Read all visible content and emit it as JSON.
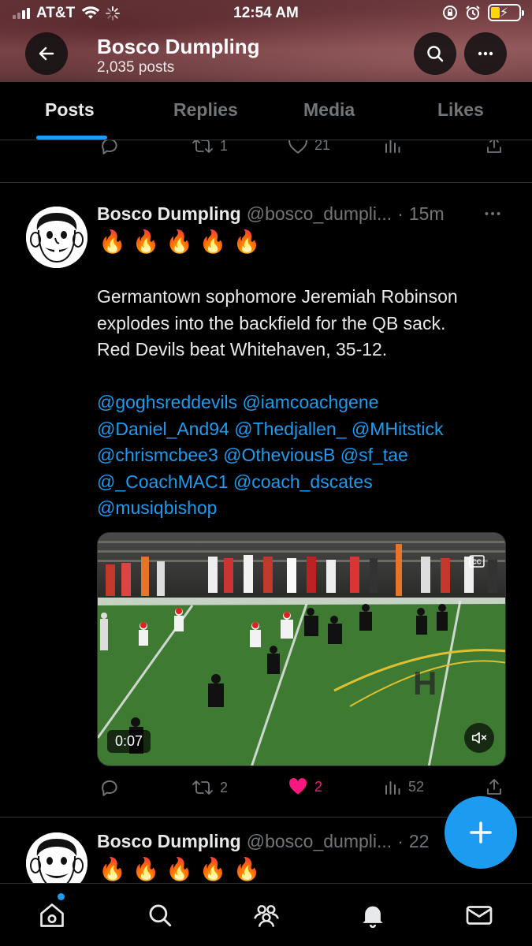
{
  "status_bar": {
    "carrier": "AT&T",
    "time": "12:54 AM"
  },
  "header": {
    "name": "Bosco Dumpling",
    "post_count": "2,035 posts"
  },
  "tabs": [
    {
      "label": "Posts",
      "active": true
    },
    {
      "label": "Replies",
      "active": false
    },
    {
      "label": "Media",
      "active": false
    },
    {
      "label": "Likes",
      "active": false
    }
  ],
  "prev_tweet_actions": {
    "replies": "",
    "reposts": "1",
    "likes": "21"
  },
  "tweet": {
    "name": "Bosco Dumpling",
    "handle": "@bosco_dumpli...",
    "dot": "·",
    "time": "15m",
    "emojis": "🔥 🔥 🔥 🔥 🔥",
    "text_lines": [
      "Germantown sophomore Jeremiah Robinson",
      "explodes into the backfield for the QB sack.",
      "Red Devils beat Whitehaven, 35-12."
    ],
    "mentions_lines": [
      "@goghsreddevils @iamcoachgene",
      "@Daniel_And94 @Thedjallen_ @MHitstick",
      "@chrismcbee3 @OtheviousB @sf_tae",
      "@_CoachMAC1 @coach_dscates",
      "@musiqbishop"
    ],
    "video": {
      "duration": "0:07"
    },
    "actions": {
      "replies": "",
      "reposts": "2",
      "likes": "2",
      "views": "52"
    }
  },
  "next_tweet": {
    "name": "Bosco Dumpling",
    "handle": "@bosco_dumpli...",
    "dot": "·",
    "time": "22",
    "emojis": "🔥 🔥 🔥 🔥 🔥"
  },
  "colors": {
    "accent": "#1d9bf0",
    "like": "#f91880",
    "muted": "#71767b",
    "text": "#e7e9ea"
  }
}
